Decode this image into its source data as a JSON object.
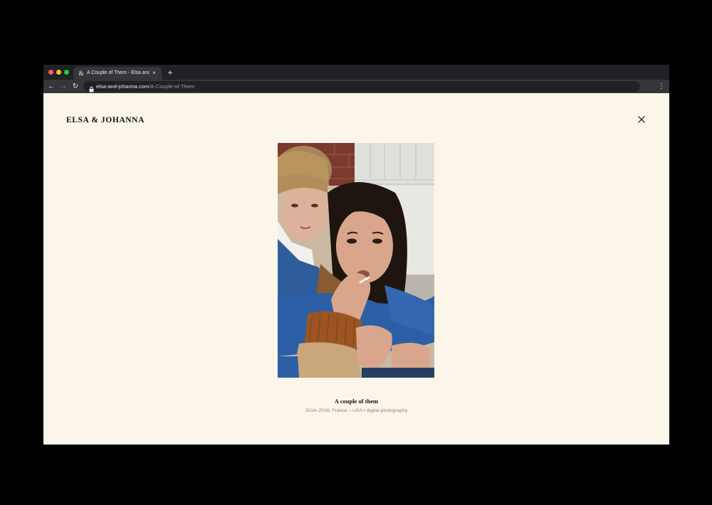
{
  "browser": {
    "tab": {
      "favicon": "&",
      "title": "A Couple of Them - Elsa and J...",
      "close": "×"
    },
    "new_tab": "+",
    "nav": {
      "back": "←",
      "forward": "→",
      "reload": "↻"
    },
    "url_host": "elsa-and-johanna.com",
    "url_path": "/A-Couple-of-Them",
    "menu": "⋮"
  },
  "site": {
    "logo": "ELSA & JOHANNA"
  },
  "artwork": {
    "title": "A couple of them",
    "meta": "2014–2016, France – USA • digital photography"
  },
  "colors": {
    "background": "#fbf6e9",
    "chrome_dark": "#202124",
    "chrome_toolbar": "#35363a"
  }
}
